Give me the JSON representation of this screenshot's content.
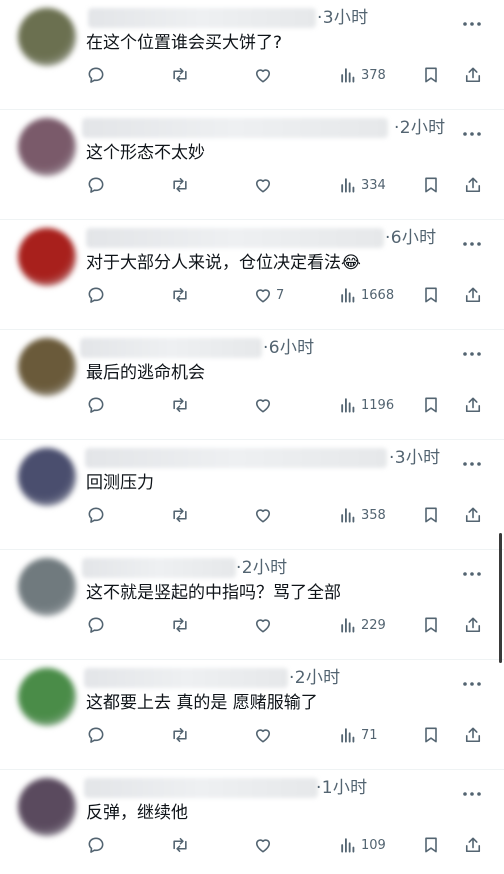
{
  "colors": {
    "icon": "#536471",
    "text": "#0f1419",
    "divider": "#eff3f4"
  },
  "tweets": [
    {
      "time": "·3小时",
      "text": "在这个位置谁会买大饼了?",
      "likes": "",
      "views": "378",
      "avatar_color": "#6b7050"
    },
    {
      "time": "·2小时",
      "text": "这个形态不太妙",
      "likes": "",
      "views": "334",
      "avatar_color": "#7a5a6a"
    },
    {
      "time": "·6小时",
      "text": "对于大部分人来说，仓位决定看法😂",
      "likes": "7",
      "views": "1668",
      "avatar_color": "#a8201c"
    },
    {
      "time": "·6小时",
      "text": "最后的逃命机会",
      "likes": "",
      "views": "1196",
      "avatar_color": "#6a5a3a"
    },
    {
      "time": "·3小时",
      "text": "回测压力",
      "likes": "",
      "views": "358",
      "avatar_color": "#4a4e6e"
    },
    {
      "time": "·2小时",
      "text": "这不就是竖起的中指吗？骂了全部",
      "likes": "",
      "views": "229",
      "avatar_color": "#707a7e"
    },
    {
      "time": "·2小时",
      "text": "这都要上去 真的是 愿赌服输了",
      "likes": "",
      "views": "71",
      "avatar_color": "#4a8c48"
    },
    {
      "time": "·1小时",
      "text": "反弹，继续他",
      "likes": "",
      "views": "109",
      "avatar_color": "#5a4a5e"
    }
  ],
  "icons": [
    "reply-icon",
    "retweet-icon",
    "like-icon",
    "views-icon",
    "bookmark-icon",
    "share-icon",
    "more-icon"
  ]
}
